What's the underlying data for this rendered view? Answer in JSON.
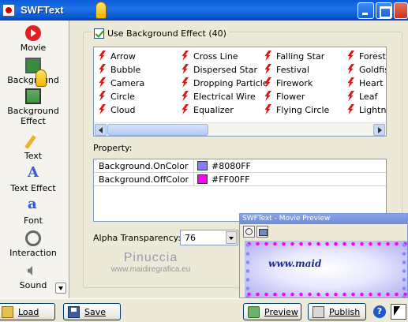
{
  "window": {
    "title": "SWFText"
  },
  "sidebar": {
    "items": [
      {
        "label": "Movie",
        "icon": "movie-icon"
      },
      {
        "label": "Background",
        "icon": "background-icon"
      },
      {
        "label": "Background Effect",
        "label_line1": "Background",
        "label_line2": "Effect",
        "icon": "background-effect-icon",
        "selected": true
      },
      {
        "label": "Text",
        "icon": "pencil-icon"
      },
      {
        "label": "Text Effect",
        "icon": "text-effect-icon"
      },
      {
        "label": "Font",
        "icon": "font-icon"
      },
      {
        "label": "Interaction",
        "icon": "interaction-icon"
      },
      {
        "label": "Sound",
        "icon": "sound-icon"
      }
    ]
  },
  "main": {
    "use_background_effect": {
      "label": "Use Background Effect (40)",
      "checked": true
    },
    "effects": {
      "columns": [
        [
          "Arrow",
          "Bubble",
          "Camera",
          "Circle",
          "Cloud"
        ],
        [
          "Cross Line",
          "Dispersed Star",
          "Dropping Particle",
          "Electrical Wire",
          "Equalizer"
        ],
        [
          "Falling Star",
          "Festival",
          "Firework",
          "Flower",
          "Flying Circle"
        ],
        [
          "Forest",
          "Goldfish",
          "Heart",
          "Leaf",
          "Lightning"
        ]
      ]
    },
    "property": {
      "label": "Property:",
      "rows": [
        {
          "name": "Background.OnColor",
          "value": "#8080FF",
          "color": "#8080FF"
        },
        {
          "name": "Background.OffColor",
          "value": "#FF00FF",
          "color": "#FF00FF"
        }
      ]
    },
    "alpha": {
      "label": "Alpha Transparency:",
      "value": "76"
    }
  },
  "toolbar": {
    "load_label": "Load",
    "save_label": "Save",
    "preview_label": "Preview",
    "publish_label": "Publish",
    "help_label": "?"
  },
  "preview_window": {
    "title": "SWFText - Movie Preview",
    "movie_text": "www.maid"
  },
  "watermark": {
    "line1": "Pinuccia",
    "line2": "www.maidiregrafica.eu"
  }
}
